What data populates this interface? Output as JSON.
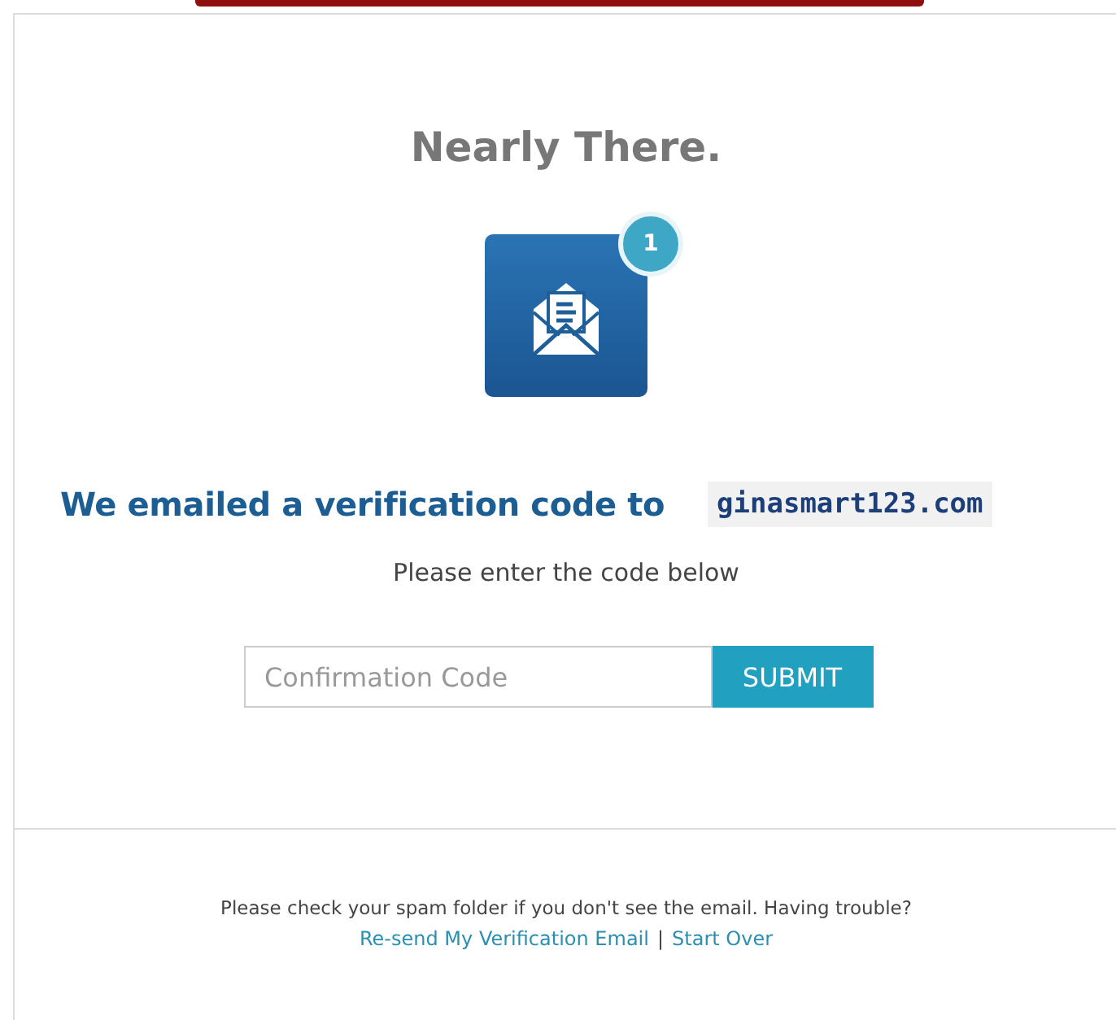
{
  "title": "Nearly There.",
  "badge": "1",
  "heading": {
    "text": "We emailed a verification code to",
    "email": "ginasmart123.com"
  },
  "instruction": "Please enter the code below",
  "code_field": {
    "placeholder": "Confirmation Code"
  },
  "submit_button": "SUBMIT",
  "footer": {
    "note": "Please check your spam folder if you don't see the email. Having trouble?",
    "links": [
      "Re-send My Verification Email",
      "Start Over"
    ],
    "separator": "|"
  }
}
